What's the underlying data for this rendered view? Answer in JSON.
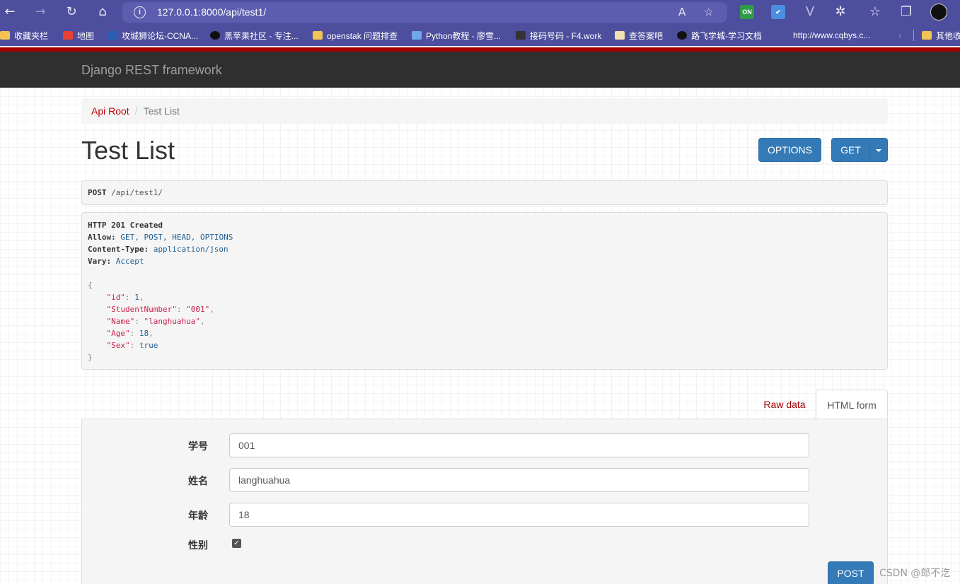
{
  "browser": {
    "url": "127.0.0.1:8000/api/test1/",
    "bookmarks": [
      {
        "label": "收藏夹栏"
      },
      {
        "label": "地图"
      },
      {
        "label": "攻城狮论坛-CCNA..."
      },
      {
        "label": "黑苹果社区 - 专注..."
      },
      {
        "label": "openstak 问题排查"
      },
      {
        "label": "Python教程 - 廖雪..."
      },
      {
        "label": "接码号码 - F4.work"
      },
      {
        "label": "查答案吧"
      },
      {
        "label": "路飞学城-学习文档"
      },
      {
        "label": "http://www.cqbys.c..."
      },
      {
        "label": "其他收"
      }
    ],
    "ext_on_label": "ON"
  },
  "navbar": {
    "brand": "Django REST framework"
  },
  "breadcrumb": {
    "root": "Api Root",
    "separator": "/",
    "current": "Test List"
  },
  "page": {
    "title": "Test List",
    "options_label": "OPTIONS",
    "get_label": "GET"
  },
  "request": {
    "method": "POST",
    "path": "/api/test1/"
  },
  "response": {
    "status": "HTTP 201 Created",
    "headers": [
      {
        "name": "Allow:",
        "value": "GET, POST, HEAD, OPTIONS"
      },
      {
        "name": "Content-Type:",
        "value": "application/json"
      },
      {
        "name": "Vary:",
        "value": "Accept"
      }
    ],
    "open_brace": "{",
    "close_brace": "}",
    "body": [
      {
        "key": "\"id\"",
        "value": "1",
        "type": "num",
        "comma": ","
      },
      {
        "key": "\"StudentNumber\"",
        "value": "\"001\"",
        "type": "str",
        "comma": ","
      },
      {
        "key": "\"Name\"",
        "value": "\"langhuahua\"",
        "type": "str",
        "comma": ","
      },
      {
        "key": "\"Age\"",
        "value": "18",
        "type": "num",
        "comma": ","
      },
      {
        "key": "\"Sex\"",
        "value": "true",
        "type": "lit",
        "comma": ""
      }
    ]
  },
  "tabs": {
    "raw": "Raw data",
    "html": "HTML form"
  },
  "form": {
    "fields": [
      {
        "label": "学号",
        "value": "001"
      },
      {
        "label": "姓名",
        "value": "langhuahua"
      },
      {
        "label": "年龄",
        "value": "18"
      }
    ],
    "checkbox_label": "性别",
    "checkbox_checked": true,
    "submit_label": "POST"
  },
  "watermark": "CSDN @郎不汔"
}
